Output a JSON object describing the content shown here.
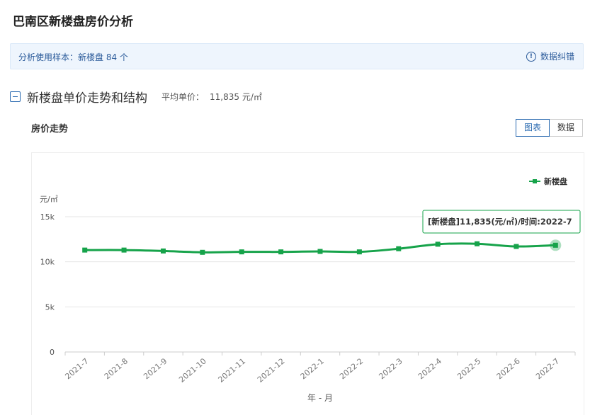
{
  "page_title": "巴南区新楼盘房价分析",
  "sample": {
    "label": "分析使用样本：",
    "value": "新楼盘 84 个"
  },
  "correction_label": "数据纠错",
  "section": {
    "title": "新楼盘单价走势和结构",
    "avg_label": "平均单价：",
    "avg_value": "11,835 元/㎡"
  },
  "trend_title": "房价走势",
  "view_toggle": {
    "chart": "图表",
    "data": "数据"
  },
  "tooltip": "[新楼盘]11,835(元/㎡)/时间:2022-7",
  "colors": {
    "line": "#16a34a",
    "accent": "#2a6ab0"
  },
  "chart_data": {
    "type": "line",
    "categories": [
      "2021-7",
      "2021-8",
      "2021-9",
      "2021-10",
      "2021-11",
      "2021-12",
      "2022-1",
      "2022-2",
      "2022-3",
      "2022-4",
      "2022-5",
      "2022-6",
      "2022-7"
    ],
    "series": [
      {
        "name": "新楼盘",
        "values": [
          11300,
          11300,
          11200,
          11050,
          11100,
          11100,
          11150,
          11100,
          11450,
          11950,
          12000,
          11700,
          11835
        ]
      }
    ],
    "ylabel": "元/㎡",
    "xlabel": "年 - 月",
    "ylim": [
      0,
      15000
    ],
    "yticks": [
      {
        "value": 0,
        "label": "0"
      },
      {
        "value": 5000,
        "label": "5k"
      },
      {
        "value": 10000,
        "label": "10k"
      },
      {
        "value": 15000,
        "label": "15k"
      }
    ],
    "legend_position": "top-right",
    "grid": true
  }
}
